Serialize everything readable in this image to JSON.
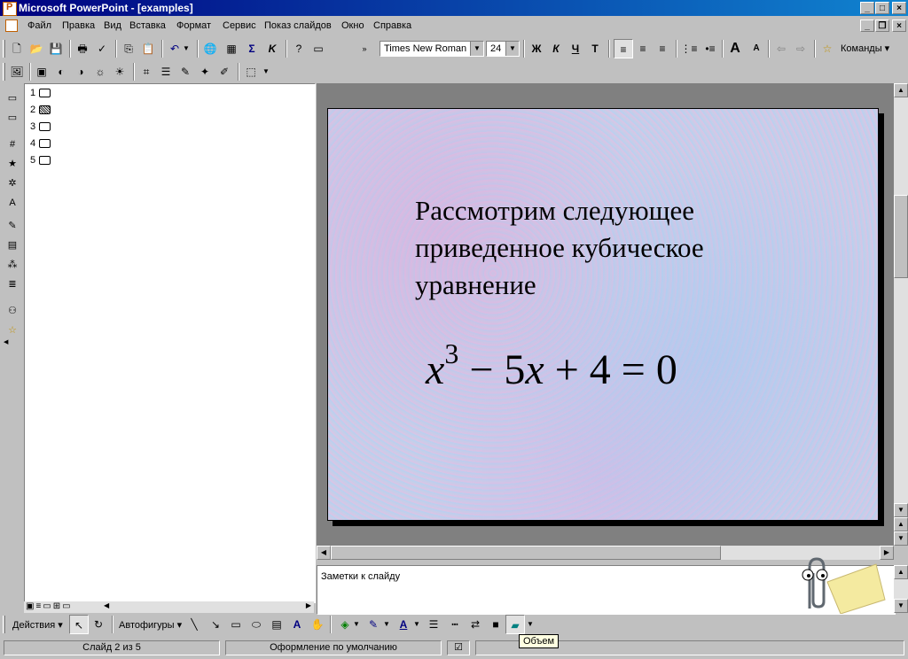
{
  "window": {
    "title": "Microsoft PowerPoint - [examples]",
    "min": "_",
    "max": "□",
    "close": "×"
  },
  "menu": [
    "Файл",
    "Правка",
    "Вид",
    "Вставка",
    "Формат",
    "Сервис",
    "Показ слайдов",
    "Окно",
    "Справка"
  ],
  "toolbar": {
    "font_name": "Times New Roman",
    "font_size": "24",
    "bold": "Ж",
    "italic": "К",
    "underline": "Ч",
    "shadow": "Т",
    "commands": "Команды"
  },
  "outline": {
    "slides": [
      {
        "num": "1",
        "filled": false
      },
      {
        "num": "2",
        "filled": true
      },
      {
        "num": "3",
        "filled": false
      },
      {
        "num": "4",
        "filled": false
      },
      {
        "num": "5",
        "filled": false
      }
    ]
  },
  "slide": {
    "text": "Рассмотрим следующее приведенное кубическое уравнение",
    "eq_x": "x",
    "eq_exp": "3",
    "eq_rest1": " − 5",
    "eq_x2": "x",
    "eq_rest2": " + 4 = 0"
  },
  "notes": {
    "text": "Заметки к слайду"
  },
  "drawing": {
    "actions": "Действия",
    "autoshapes": "Автофигуры",
    "tooltip": "Объем"
  },
  "status": {
    "slide_pos": "Слайд 2 из 5",
    "design": "Оформление по умолчанию"
  }
}
